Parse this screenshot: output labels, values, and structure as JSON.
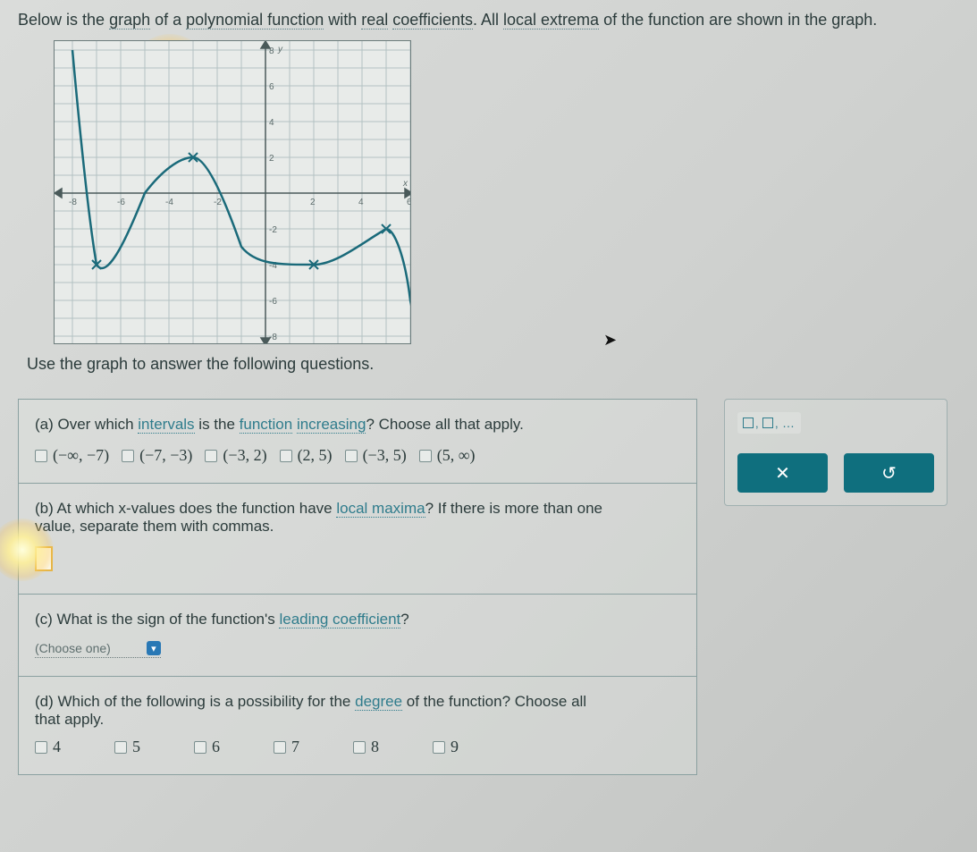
{
  "intro": {
    "t1": "Below is the ",
    "u1": "graph",
    "t2": " of a ",
    "u2": "polynomial function",
    "t3": " with ",
    "u3": "real",
    "t4": " ",
    "u4": "coefficients",
    "t5": ". All ",
    "u5": "local extrema",
    "t6": " of the function are shown in the graph."
  },
  "graph": {
    "y_label": "y",
    "x_label": "x",
    "x_ticks": [
      "-8",
      "-6",
      "-4",
      "-2",
      "2",
      "4",
      "6"
    ],
    "y_ticks": [
      "8",
      "6",
      "4",
      "2",
      "-2",
      "-4",
      "-6",
      "-8"
    ]
  },
  "use_text": "Use the graph to answer the following questions.",
  "qa": {
    "pre": "(a) Over which ",
    "u1": "intervals",
    "mid": " is the ",
    "u2": "function",
    "mid2": " ",
    "u3": "increasing",
    "post": "? Choose all that apply.",
    "opts": [
      "(−∞, −7)",
      "(−7, −3)",
      "(−3, 2)",
      "(2, 5)",
      "(−3, 5)",
      "(5, ∞)"
    ]
  },
  "qb": {
    "line1_pre": "(b) At which x-values does the function have ",
    "line1_link": "local maxima",
    "line1_post": "? If there is more than one",
    "line2": "value, separate them with commas."
  },
  "qc": {
    "pre": "(c) What is the sign of the function's ",
    "link": "leading coefficient",
    "post": "?",
    "select": "(Choose one)"
  },
  "qd": {
    "pre": "(d) Which of the following is a possibility for the ",
    "link": "degree",
    "post": " of the function? Choose all",
    "line2": "that apply.",
    "opts": [
      "4",
      "5",
      "6",
      "7",
      "8",
      "9"
    ]
  },
  "side": {
    "x": "✕",
    "reset": "↺"
  },
  "chart_data": {
    "type": "line",
    "title": "",
    "xlabel": "x",
    "ylabel": "y",
    "xlim": [
      -8,
      7
    ],
    "ylim": [
      -8,
      8
    ],
    "grid": true,
    "series": [
      {
        "name": "polynomial",
        "x": [
          -8,
          -7.5,
          -7,
          -6,
          -5,
          -4,
          -3,
          -2,
          -1,
          0,
          1,
          2,
          3,
          4,
          5,
          5.5,
          6,
          6.5
        ],
        "y": [
          8,
          0,
          -4,
          -2,
          0,
          1,
          2,
          0,
          -3,
          -4,
          -4,
          -4,
          -3.5,
          -2.5,
          -2,
          -2.5,
          -5,
          -9
        ]
      }
    ],
    "extrema": [
      {
        "x": -7,
        "y": -4,
        "type": "min"
      },
      {
        "x": -3,
        "y": 2,
        "type": "max"
      },
      {
        "x": 2,
        "y": -4,
        "type": "min"
      },
      {
        "x": 5,
        "y": -2,
        "type": "max"
      }
    ]
  }
}
